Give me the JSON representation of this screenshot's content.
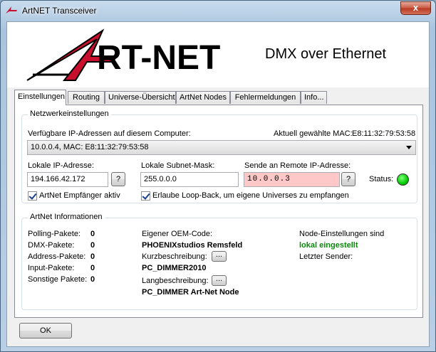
{
  "window": {
    "title": "ArtNET Transceiver",
    "close_glyph": "x"
  },
  "banner": {
    "logo_text": "RT-NET",
    "tagline": "DMX over Ethernet"
  },
  "tabs": [
    {
      "label": "Einstellungen"
    },
    {
      "label": "Routing"
    },
    {
      "label": "Universe-Übersicht"
    },
    {
      "label": "ArtNet Nodes"
    },
    {
      "label": "Fehlermeldungen"
    },
    {
      "label": "Info..."
    }
  ],
  "network": {
    "legend": "Netzwerkeinstellungen",
    "available_ips_label": "Verfügbare IP-Adressen auf diesem Computer:",
    "current_mac_label": "Aktuell gewählte MAC:",
    "current_mac": "E8:11:32:79:53:58",
    "ip_select_value": "10.0.0.4, MAC: E8:11:32:79:53:58",
    "local_ip_label": "Lokale IP-Adresse:",
    "local_ip_value": "194.166.42.172",
    "subnet_label": "Lokale Subnet-Mask:",
    "subnet_value": "255.0.0.0",
    "remote_ip_label": "Sende an Remote IP-Adresse:",
    "remote_ip_value": "10.0.0.3",
    "help_button": "?",
    "status_label": "Status:",
    "receiver_active_label": "ArtNet Empfänger aktiv",
    "loopback_label": "Erlaube Loop-Back, um eigene Universes zu empfangen"
  },
  "info": {
    "legend": "ArtNet Informationen",
    "counters": [
      {
        "label": "Polling-Pakete:",
        "value": "0"
      },
      {
        "label": "DMX-Pakete:",
        "value": "0"
      },
      {
        "label": "Address-Pakete:",
        "value": "0"
      },
      {
        "label": "Input-Pakete:",
        "value": "0"
      },
      {
        "label": "Sonstige Pakete:",
        "value": "0"
      }
    ],
    "oem_label": "Eigener OEM-Code:",
    "oem_value": "PHOENIXstudios Remsfeld",
    "short_label": "Kurzbeschreibung:",
    "short_value": "PC_DIMMER2010",
    "long_label": "Langbeschreibung:",
    "long_value": "PC_DIMMER Art-Net Node",
    "ellipsis_button": "...",
    "node_settings_label": "Node-Einstellungen sind",
    "node_settings_value": "lokal eingestellt",
    "last_sender_label": "Letzter Sender:"
  },
  "footer": {
    "ok_label": "OK"
  }
}
